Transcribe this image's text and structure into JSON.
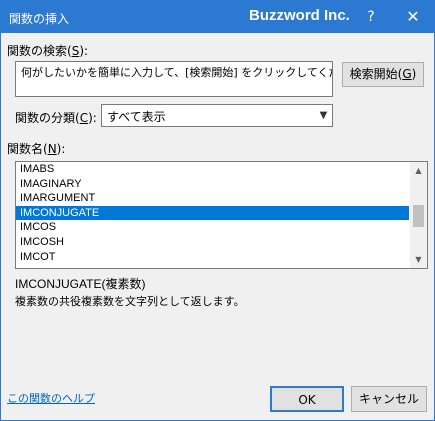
{
  "window": {
    "title": "関数の挿入",
    "brand": "Buzzword Inc.",
    "help_glyph": "?",
    "close_glyph": "✕"
  },
  "search": {
    "label_main": "関数の検索(",
    "label_key": "S",
    "label_end": "):",
    "value": "何がしたいかを簡単に入力して、[検索開始] をクリックしてください。",
    "button_main": "検索開始(",
    "button_key": "G",
    "button_end": ")"
  },
  "category": {
    "label_main": "関数の分類(",
    "label_key": "C",
    "label_end": "):",
    "selected": "すべて表示"
  },
  "function_list": {
    "label_main": "関数名(",
    "label_key": "N",
    "label_end": "):",
    "items": [
      "IMABS",
      "IMAGINARY",
      "IMARGUMENT",
      "IMCONJUGATE",
      "IMCOS",
      "IMCOSH",
      "IMCOT"
    ],
    "selected": "IMCONJUGATE"
  },
  "description": {
    "signature": "IMCONJUGATE(複素数)",
    "text": "複素数の共役複素数を文字列として返します。"
  },
  "footer": {
    "help_link": "この関数のヘルプ",
    "ok": "OK",
    "cancel": "キャンセル"
  }
}
